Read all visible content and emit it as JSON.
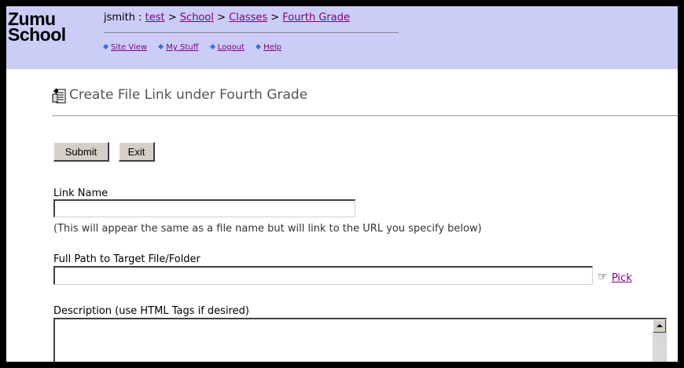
{
  "logo": {
    "line1": "Zumu",
    "line2": "School"
  },
  "breadcrumb": {
    "user": "jsmith",
    "separator_user": " : ",
    "separator": " > ",
    "items": [
      "test",
      "School",
      "Classes",
      "Fourth Grade"
    ]
  },
  "nav": {
    "items": [
      "Site View",
      "My Stuff",
      "Logout",
      "Help"
    ]
  },
  "page": {
    "title": "Create File Link under Fourth Grade"
  },
  "buttons": {
    "submit": "Submit",
    "exit": "Exit"
  },
  "form": {
    "link_name": {
      "label": "Link Name",
      "value": "",
      "note": "(This will appear the same as a file name but will link to the URL you specify below)"
    },
    "full_path": {
      "label": "Full Path to Target File/Folder",
      "value": "",
      "pick_label": "Pick"
    },
    "description": {
      "label": "Description (use HTML Tags if desired)",
      "value": ""
    }
  },
  "colors": {
    "header_bg": "#cccdf7",
    "link": "#800080",
    "nav_bullet": "#3a6fd8"
  }
}
